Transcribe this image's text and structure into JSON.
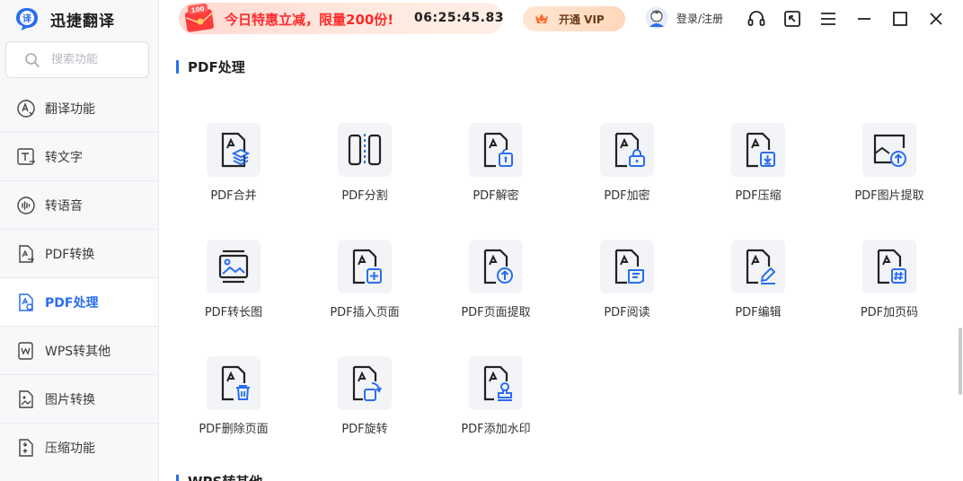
{
  "app": {
    "name": "迅捷翻译"
  },
  "search": {
    "placeholder": "搜索功能"
  },
  "sidebar": {
    "items": [
      {
        "label": "翻译功能",
        "icon": "translate-icon"
      },
      {
        "label": "转文字",
        "icon": "text-convert-icon"
      },
      {
        "label": "转语音",
        "icon": "voice-icon"
      },
      {
        "label": "PDF转换",
        "icon": "pdf-convert-icon"
      },
      {
        "label": "PDF处理",
        "icon": "pdf-process-icon",
        "active": true
      },
      {
        "label": "WPS转其他",
        "icon": "wps-icon"
      },
      {
        "label": "图片转换",
        "icon": "image-convert-icon"
      },
      {
        "label": "压缩功能",
        "icon": "compress-icon"
      }
    ]
  },
  "topbar": {
    "promo_badge": "100",
    "promo_text": "今日特惠立减，限量200份!",
    "countdown": "06:25:45.83",
    "vip_label": "开通 VIP",
    "login_label": "登录/注册"
  },
  "main": {
    "section_title": "PDF处理",
    "next_section_title": "WPS转其他",
    "tools": [
      {
        "label": "PDF合并",
        "icon": "pdf-merge-icon"
      },
      {
        "label": "PDF分割",
        "icon": "pdf-split-icon"
      },
      {
        "label": "PDF解密",
        "icon": "pdf-decrypt-icon"
      },
      {
        "label": "PDF加密",
        "icon": "pdf-encrypt-icon"
      },
      {
        "label": "PDF压缩",
        "icon": "pdf-compress-icon"
      },
      {
        "label": "PDF图片提取",
        "icon": "pdf-image-extract-icon"
      },
      {
        "label": "PDF转长图",
        "icon": "pdf-long-image-icon"
      },
      {
        "label": "PDF插入页面",
        "icon": "pdf-insert-page-icon"
      },
      {
        "label": "PDF页面提取",
        "icon": "pdf-page-extract-icon"
      },
      {
        "label": "PDF阅读",
        "icon": "pdf-read-icon"
      },
      {
        "label": "PDF编辑",
        "icon": "pdf-edit-icon"
      },
      {
        "label": "PDF加页码",
        "icon": "pdf-page-number-icon"
      },
      {
        "label": "PDF删除页面",
        "icon": "pdf-delete-page-icon"
      },
      {
        "label": "PDF旋转",
        "icon": "pdf-rotate-icon"
      },
      {
        "label": "PDF添加水印",
        "icon": "pdf-watermark-icon"
      }
    ]
  },
  "colors": {
    "accent": "#2a6ef1",
    "promo_red": "#ff2a2a",
    "tile_bg": "#f2f4f7"
  }
}
